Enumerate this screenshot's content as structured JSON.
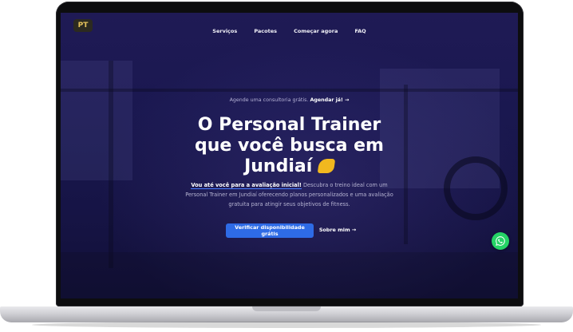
{
  "nav": {
    "logo_text": "PT",
    "items": [
      {
        "label": "Serviços"
      },
      {
        "label": "Pacotes"
      },
      {
        "label": "Começar agora"
      },
      {
        "label": "FAQ"
      }
    ]
  },
  "hero": {
    "consult_text": "Agende uma consultoria grátis.",
    "consult_link": "Agendar já! →",
    "title_line1": "O Personal Trainer",
    "title_line2": "que você busca em",
    "title_line3": "Jundiaí",
    "desc_strong": "Vou até você para a avaliação inicial!",
    "desc_rest": " Descubra o treino ideal com um Personal Trainer em Jundiaí oferecendo planos personalizados e uma avaliação gratuita para atingir seus objetivos de fitness.",
    "cta_label": "Verificar disponibilidade grátis",
    "about_label": "Sobre mim →"
  },
  "colors": {
    "screen_bg": "#1a1850",
    "cta": "#2e6be6",
    "whatsapp": "#25d366",
    "muscle": "#f1b81f"
  },
  "icons": {
    "muscle": "flexed-biceps-icon",
    "whatsapp": "whatsapp-icon"
  }
}
